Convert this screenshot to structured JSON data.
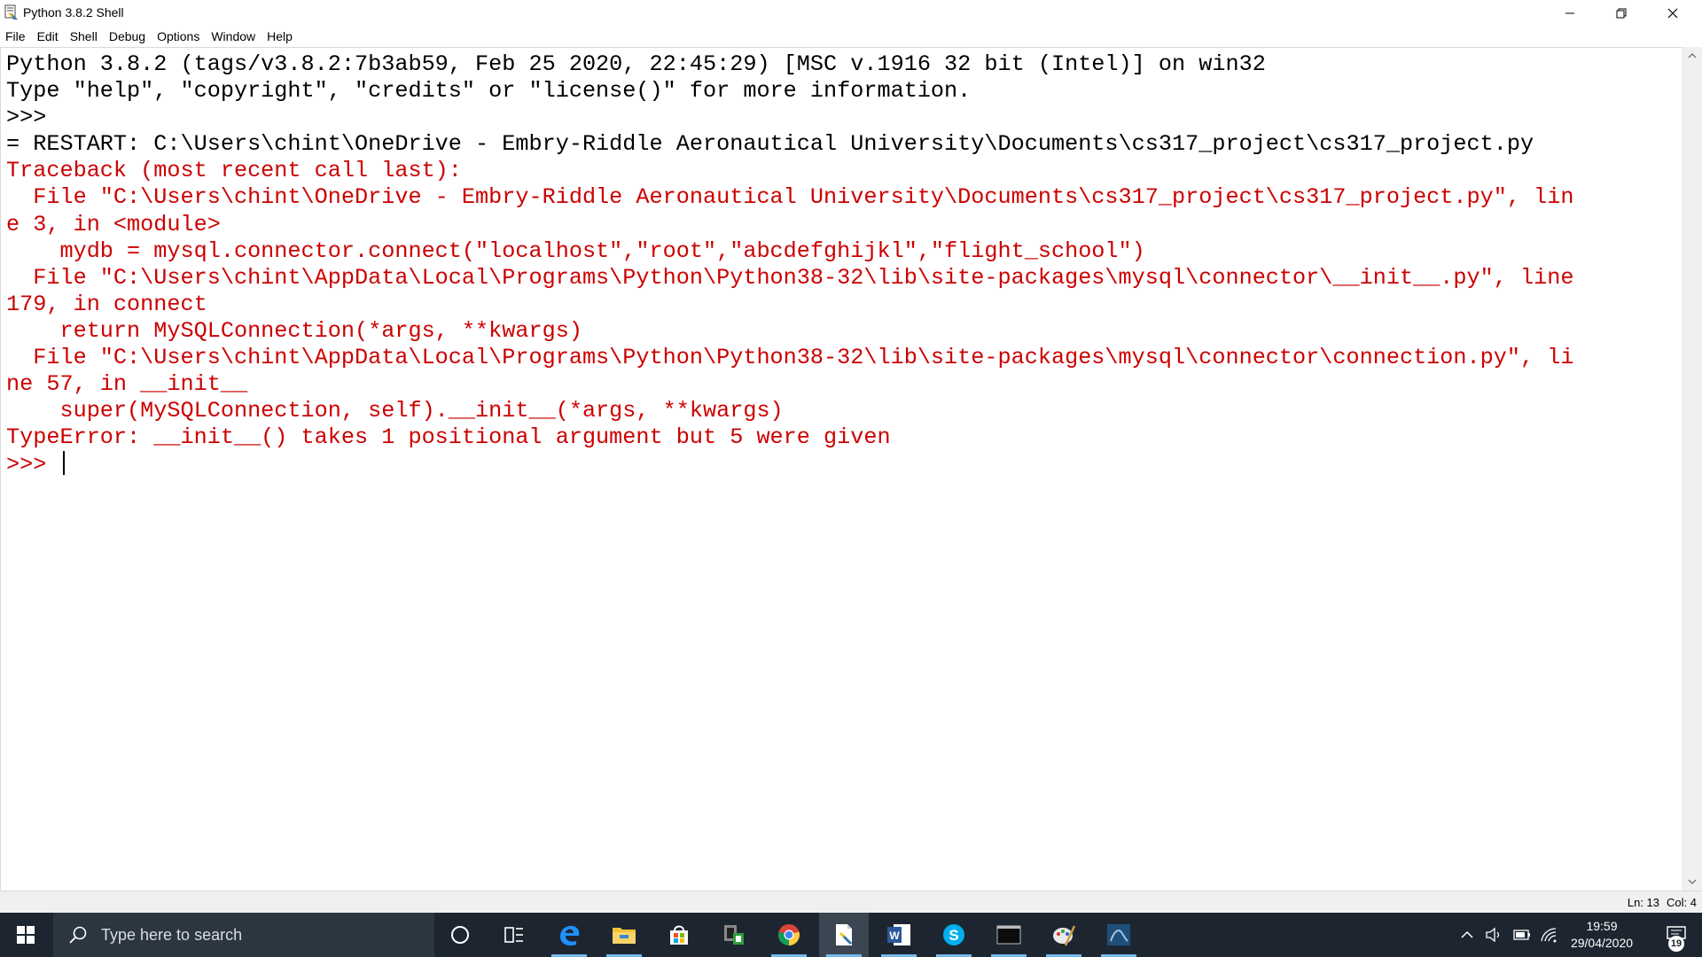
{
  "window": {
    "title": "Python 3.8.2 Shell"
  },
  "menu": [
    "File",
    "Edit",
    "Shell",
    "Debug",
    "Options",
    "Window",
    "Help"
  ],
  "shell": {
    "lines": [
      {
        "text": "Python 3.8.2 (tags/v3.8.2:7b3ab59, Feb 25 2020, 22:45:29) [MSC v.1916 32 bit (Intel)] on win32",
        "kind": "out"
      },
      {
        "text": "Type \"help\", \"copyright\", \"credits\" or \"license()\" for more information.",
        "kind": "out"
      },
      {
        "text": ">>> ",
        "kind": "out"
      },
      {
        "text": "= RESTART: C:\\Users\\chint\\OneDrive - Embry-Riddle Aeronautical University\\Documents\\cs317_project\\cs317_project.py",
        "kind": "out"
      },
      {
        "text": "Traceback (most recent call last):",
        "kind": "err"
      },
      {
        "text": "  File \"C:\\Users\\chint\\OneDrive - Embry-Riddle Aeronautical University\\Documents\\cs317_project\\cs317_project.py\", lin",
        "kind": "err"
      },
      {
        "text": "e 3, in <module>",
        "kind": "err"
      },
      {
        "text": "    mydb = mysql.connector.connect(\"localhost\",\"root\",\"abcdefghijkl\",\"flight_school\")",
        "kind": "err"
      },
      {
        "text": "  File \"C:\\Users\\chint\\AppData\\Local\\Programs\\Python\\Python38-32\\lib\\site-packages\\mysql\\connector\\__init__.py\", line",
        "kind": "err"
      },
      {
        "text": "179, in connect",
        "kind": "err"
      },
      {
        "text": "    return MySQLConnection(*args, **kwargs)",
        "kind": "err"
      },
      {
        "text": "  File \"C:\\Users\\chint\\AppData\\Local\\Programs\\Python\\Python38-32\\lib\\site-packages\\mysql\\connector\\connection.py\", li",
        "kind": "err"
      },
      {
        "text": "ne 57, in __init__",
        "kind": "err"
      },
      {
        "text": "    super(MySQLConnection, self).__init__(*args, **kwargs)",
        "kind": "err"
      },
      {
        "text": "TypeError: __init__() takes 1 positional argument but 5 were given",
        "kind": "err"
      },
      {
        "text": ">>> ",
        "kind": "err",
        "cursor": true
      }
    ]
  },
  "status": {
    "line": "Ln: 13",
    "col": "Col: 4"
  },
  "taskbar": {
    "search_placeholder": "Type here to search",
    "time": "19:59",
    "date": "29/04/2020",
    "notification_count": "19",
    "apps": [
      "cortana-icon",
      "task-view-icon",
      "edge-icon",
      "file-explorer-icon",
      "store-icon",
      "phone-link-icon",
      "chrome-icon",
      "idle-icon",
      "word-icon",
      "skype-icon",
      "terminal-icon",
      "paint-icon",
      "workbench-icon"
    ]
  },
  "colors": {
    "error_text": "#cc0000",
    "taskbar_bg": "#1d2630",
    "active_indicator": "#76b9ed"
  }
}
